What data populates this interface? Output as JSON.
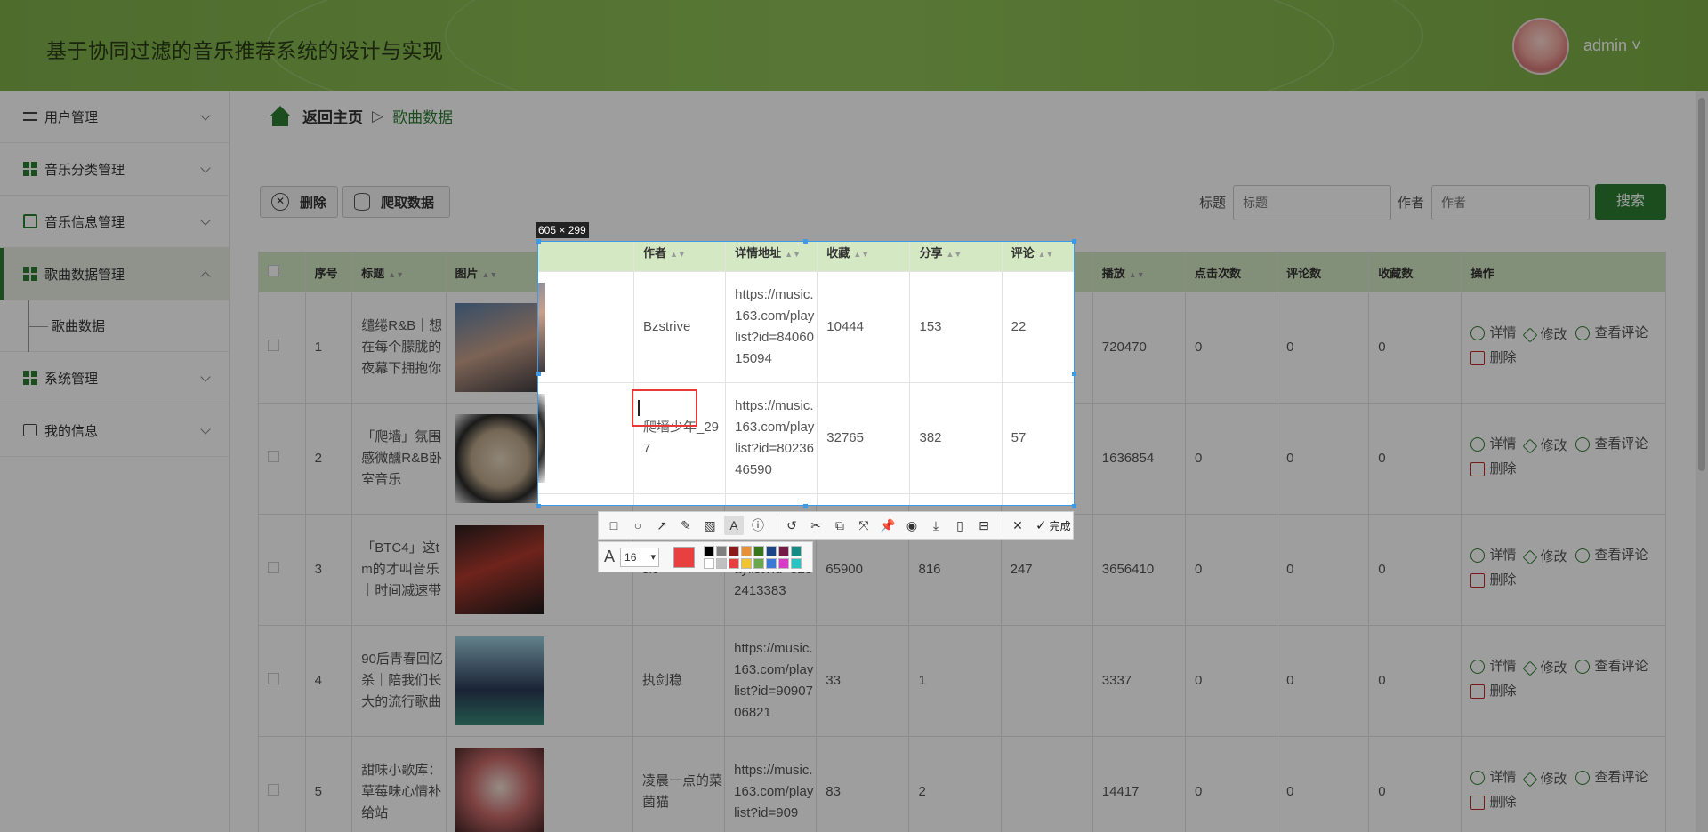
{
  "header": {
    "title": "基于协同过滤的音乐推荐系统的设计与实现",
    "user": "admin ˅"
  },
  "sidebar": {
    "items": [
      {
        "label": "用户管理"
      },
      {
        "label": "音乐分类管理"
      },
      {
        "label": "音乐信息管理"
      },
      {
        "label": "歌曲数据管理"
      },
      {
        "label": "系统管理"
      },
      {
        "label": "我的信息"
      }
    ],
    "sub_item": "歌曲数据"
  },
  "breadcrumb": {
    "home": "返回主页",
    "sep": "▷",
    "current": "歌曲数据"
  },
  "toolbar": {
    "delete": "删除",
    "crawl": "爬取数据"
  },
  "search": {
    "title_label": "标题",
    "title_placeholder": "标题",
    "author_label": "作者",
    "author_placeholder": "作者",
    "button": "搜索"
  },
  "table": {
    "headers": [
      "",
      "序号",
      "标题",
      "图片",
      "作者",
      "详情地址",
      "收藏",
      "分享",
      "评论",
      "播放",
      "点击次数",
      "评论数",
      "收藏数",
      "操作"
    ],
    "rows": [
      {
        "no": "1",
        "title": "缱绻R&B｜想在每个朦胧的夜幕下拥抱你",
        "author": "Bzstrive",
        "url": "https://music.163.com/playlist?id=8406015094",
        "fav": "10444",
        "share": "153",
        "comment": "22",
        "play": "720470",
        "clicks": "0",
        "comments": "0",
        "favs": "0"
      },
      {
        "no": "2",
        "title": "「爬墙」氛围感微醺R&B卧室音乐",
        "author": "爬墙少年_297",
        "url": "https://music.163.com/playlist?id=8023646590",
        "fav": "32765",
        "share": "382",
        "comment": "57",
        "play": "1636854",
        "clicks": "0",
        "comments": "0",
        "favs": "0"
      },
      {
        "no": "3",
        "title": "「BTC4」这tm的才叫音乐｜时间减速带",
        "author": "sic",
        "url": "ic.163.com/playlist?id=8282413383",
        "fav": "65900",
        "share": "816",
        "comment": "247",
        "play": "3656410",
        "clicks": "0",
        "comments": "0",
        "favs": "0"
      },
      {
        "no": "4",
        "title": "90后青春回忆杀｜陪我们长大的流行歌曲",
        "author": "执剑稳",
        "url": "https://music.163.com/playlist?id=9090706821",
        "fav": "33",
        "share": "1",
        "comment": "",
        "play": "3337",
        "clicks": "0",
        "comments": "0",
        "favs": "0"
      },
      {
        "no": "5",
        "title": "甜味小歌库：草莓味心情补给站",
        "author": "凌晨一点的菜菌猫",
        "url": "https://music.163.com/playlist?id=909",
        "fav": "83",
        "share": "2",
        "comment": "",
        "play": "14417",
        "clicks": "0",
        "comments": "0",
        "favs": "0"
      }
    ],
    "ops": {
      "detail": "详情",
      "edit": "修改",
      "view_comments": "查看评论",
      "delete": "删除"
    }
  },
  "capture": {
    "size": "605 × 299",
    "font_size": "16",
    "done": "完成",
    "color": "#e84040"
  },
  "colors": {
    "accent": "#2e7d32",
    "header": "#8fc158",
    "table_head": "#d4e8c4"
  }
}
